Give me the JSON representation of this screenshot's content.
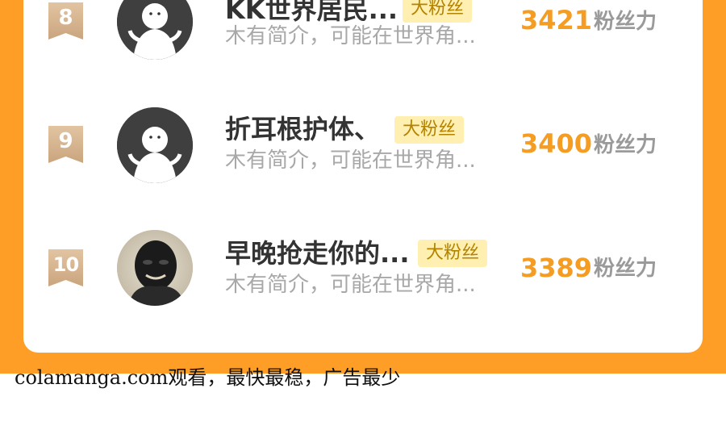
{
  "fan_badge_label": "大粉丝",
  "score_unit": "粉丝力",
  "ranking": [
    {
      "rank": "8",
      "name": "KK世界居民...",
      "intro": "木有简介，可能在世界角...",
      "score": "3421",
      "avatar": "default-avatar"
    },
    {
      "rank": "9",
      "name": "折耳根护体、",
      "intro": "木有简介，可能在世界角...",
      "score": "3400",
      "avatar": "default-avatar"
    },
    {
      "rank": "10",
      "name": "早晚抢走你的...",
      "intro": "木有简介，可能在世界角...",
      "score": "3389",
      "avatar": "photo-avatar"
    }
  ],
  "watermark": "colamanga.com观看，最快最稳，广告最少",
  "colors": {
    "frame_orange": "#ff9e27",
    "score_orange": "#f59d22",
    "badge_bg": "#ffefb0",
    "rank_badge": "#d9b894"
  }
}
